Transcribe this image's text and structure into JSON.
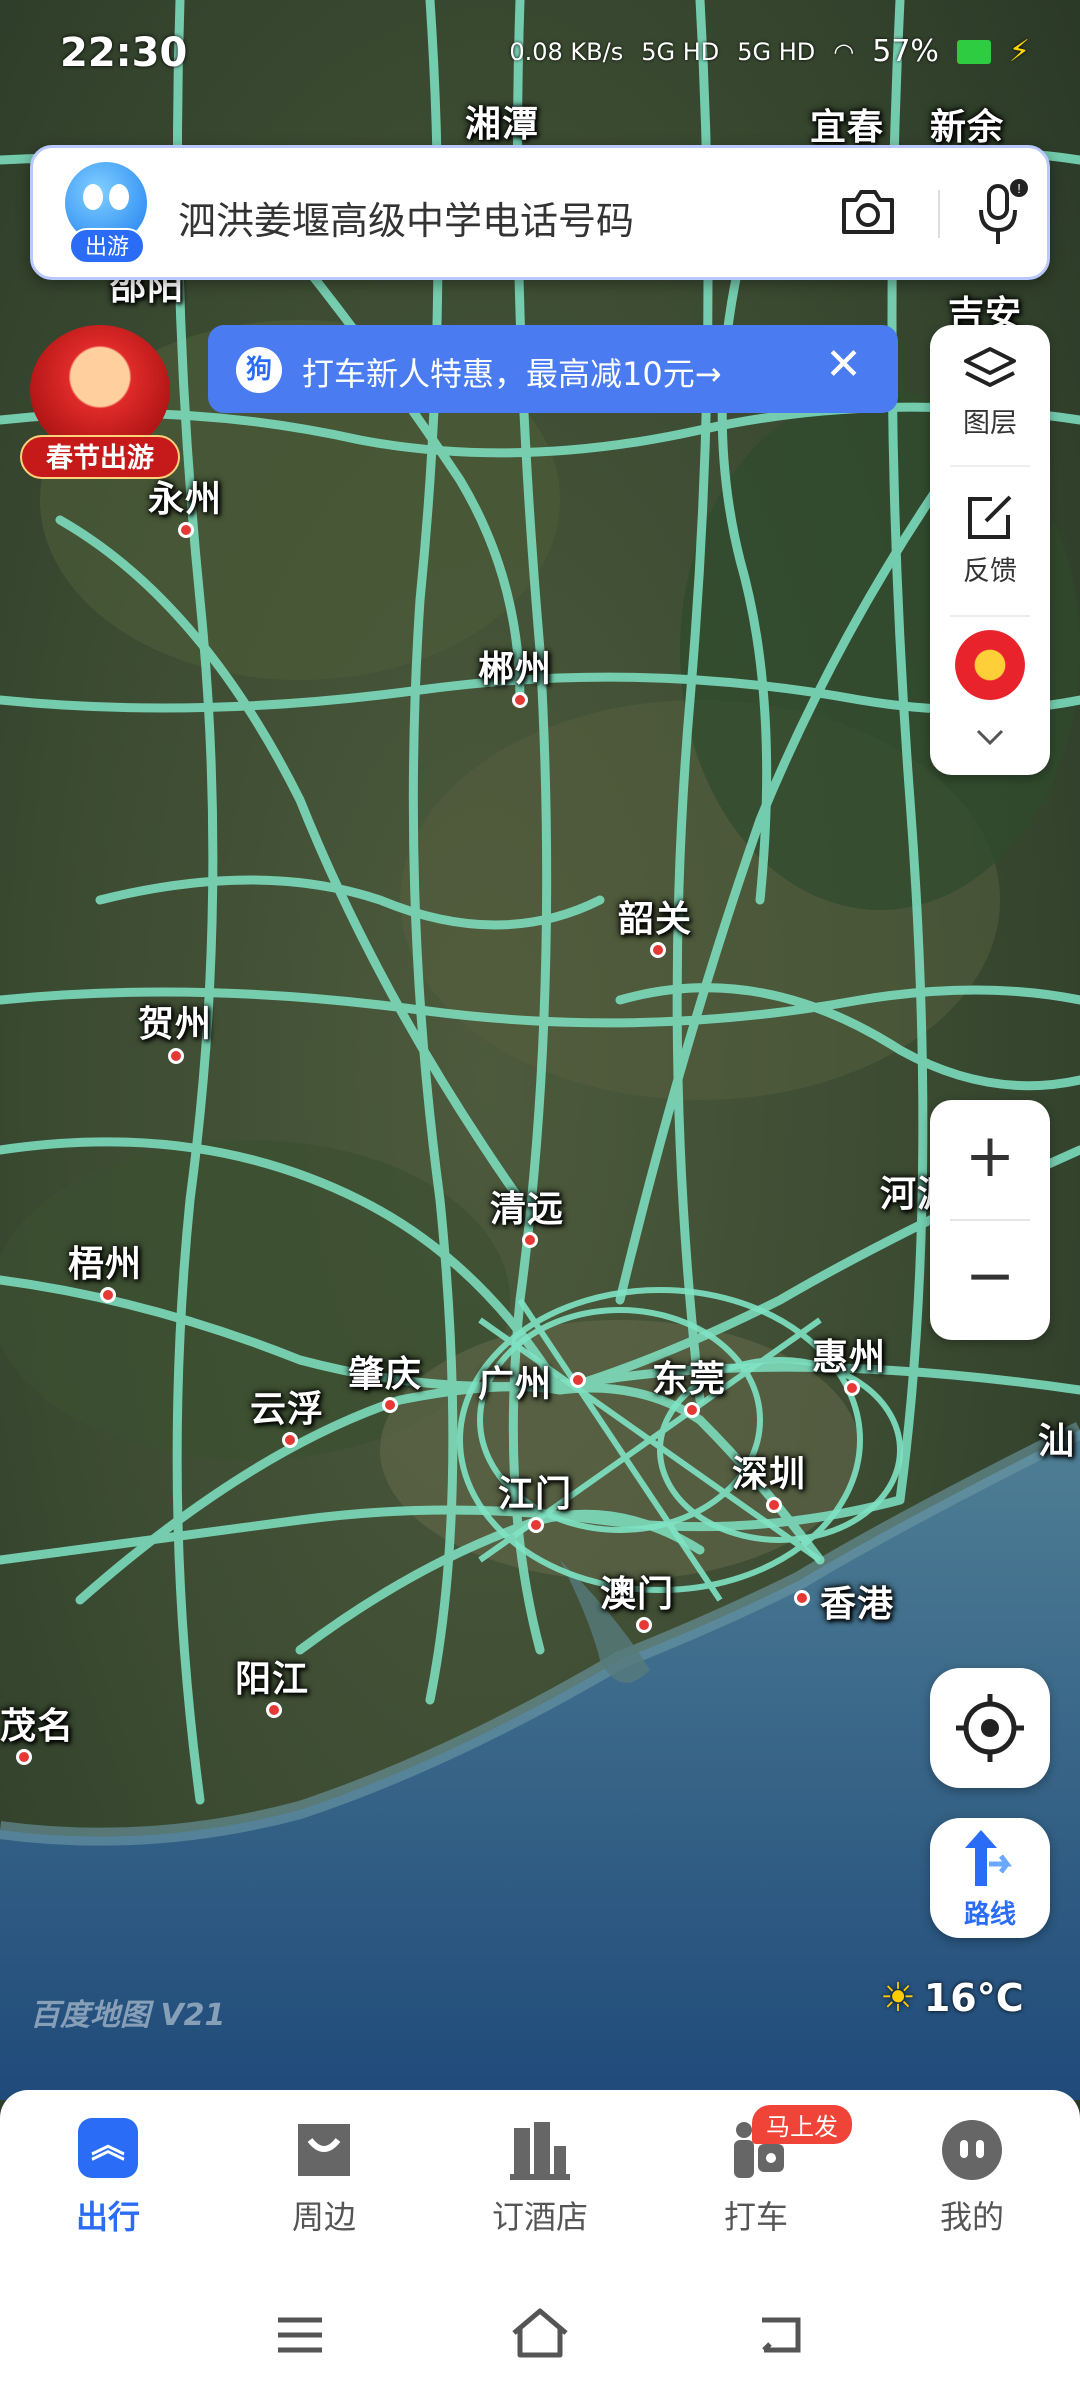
{
  "status_bar": {
    "time": "22:30",
    "speed": "0.08 KB/s",
    "net1": "5G HD",
    "net2": "5G HD",
    "battery": "57%"
  },
  "search": {
    "logo_badge": "出游",
    "query": "泗洪姜堰高级中学电话号码"
  },
  "promo": {
    "icon_text": "狗",
    "text": "打车新人特惠，最高减10元→",
    "close": "✕"
  },
  "festival": {
    "label": "春节出游"
  },
  "right_panel": {
    "layers_label": "图层",
    "feedback_label": "反馈"
  },
  "zoom": {
    "in": "+",
    "out": "−"
  },
  "route": {
    "label": "路线"
  },
  "weather": {
    "temp": "16°C",
    "icon": "sun-icon"
  },
  "map": {
    "watermark": "百度地图 V21",
    "road_color": "#7fe3c4",
    "cities": [
      {
        "name": "湘潭"
      },
      {
        "name": "宜春"
      },
      {
        "name": "新余"
      },
      {
        "name": "邵阳"
      },
      {
        "name": "吉安"
      },
      {
        "name": "永州"
      },
      {
        "name": "郴州"
      },
      {
        "name": "韶关"
      },
      {
        "name": "贺州"
      },
      {
        "name": "清远"
      },
      {
        "name": "河源"
      },
      {
        "name": "梧州"
      },
      {
        "name": "肇庆"
      },
      {
        "name": "广州"
      },
      {
        "name": "东莞"
      },
      {
        "name": "惠州"
      },
      {
        "name": "云浮"
      },
      {
        "name": "江门"
      },
      {
        "name": "深圳"
      },
      {
        "name": "汕"
      },
      {
        "name": "澳门"
      },
      {
        "name": "香港"
      },
      {
        "name": "阳江"
      },
      {
        "name": "茂名"
      }
    ]
  },
  "bottom_nav": {
    "items": [
      {
        "label": "出行",
        "icon": "travel-icon",
        "active": true
      },
      {
        "label": "周边",
        "icon": "nearby-icon"
      },
      {
        "label": "订酒店",
        "icon": "hotel-icon"
      },
      {
        "label": "打车",
        "icon": "taxi-icon"
      },
      {
        "label": "我的",
        "icon": "profile-icon"
      }
    ],
    "taxi_badge": "马上发"
  }
}
